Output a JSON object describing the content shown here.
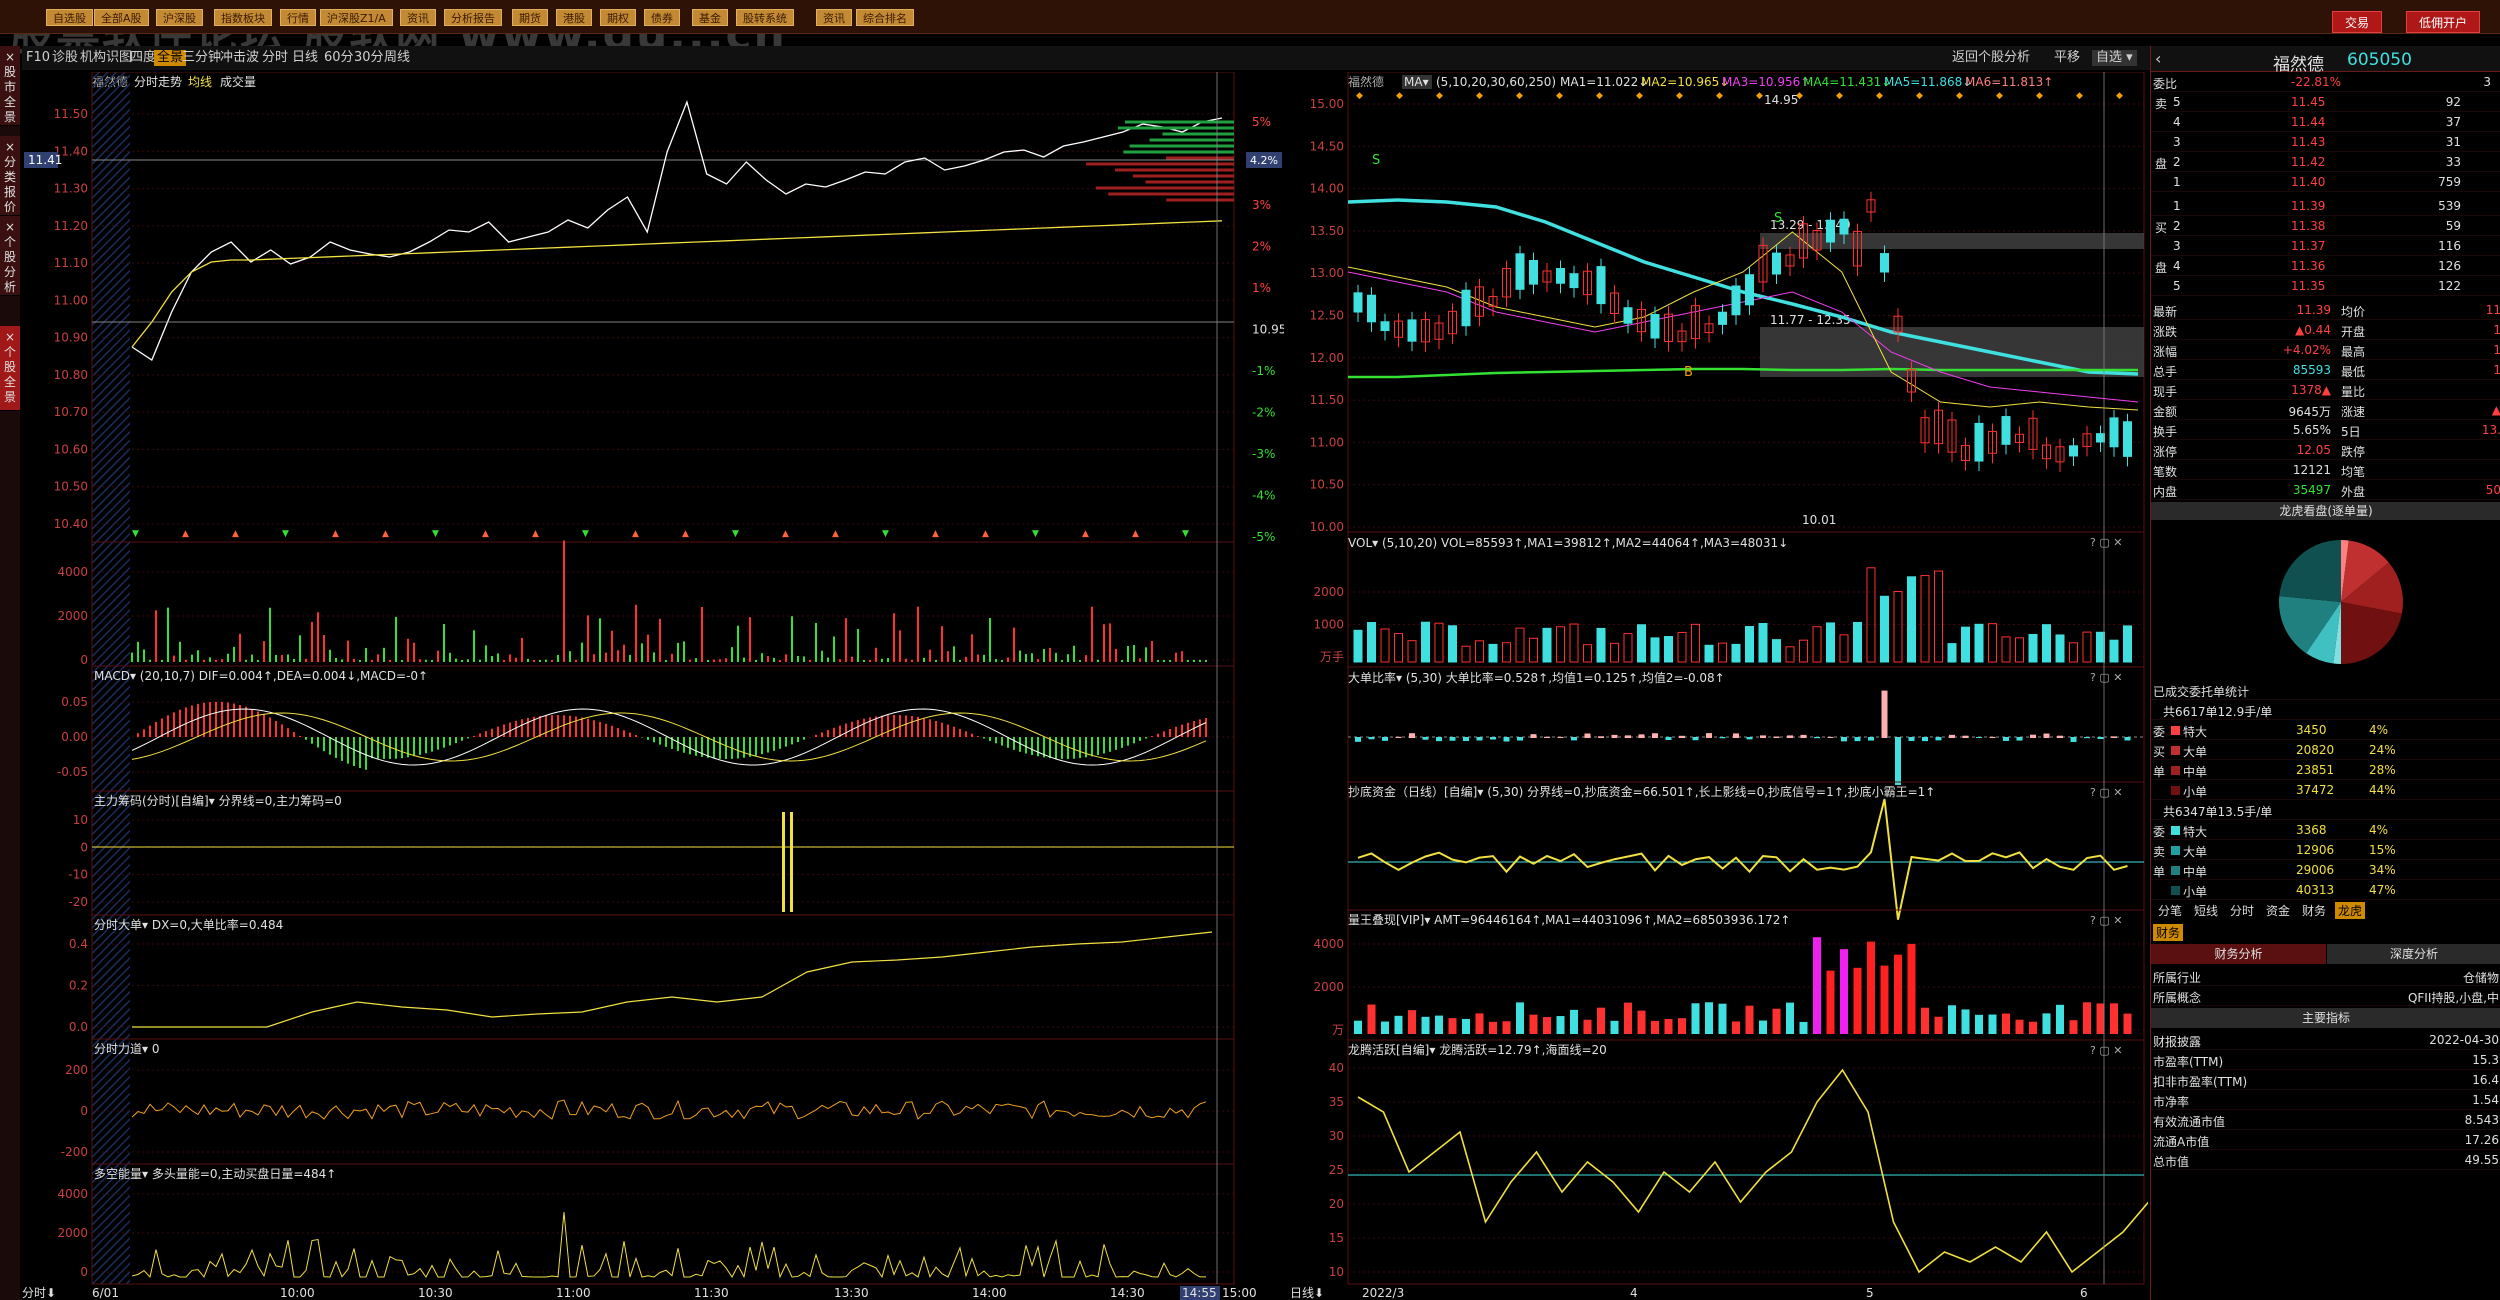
{
  "watermark": "股票软件论坛 股软网 www.gu...cn",
  "topbar": {
    "items": [
      "自选股",
      "全部A股",
      "沪深股",
      "指数板块",
      "行情",
      "沪深股Z1/A",
      "资讯",
      "分析报告",
      "期货",
      "港股",
      "期权",
      "债券",
      "基金",
      "股转系统",
      "资讯",
      "综合排名"
    ],
    "trade": "交易",
    "margin": "低佣开户"
  },
  "toolbar": {
    "items": [
      "F10",
      "诊股",
      "机构",
      "识图",
      "四度",
      "全景",
      "三分钟",
      "冲击波",
      "分时",
      "日线",
      "60分",
      "30分",
      "周线"
    ],
    "right": [
      "返回个股分析",
      "平移",
      "自选"
    ]
  },
  "lefttabs": [
    "股市全景",
    "分类报价",
    "个股分析",
    "个股全景"
  ],
  "intraday": {
    "title": "福然德",
    "mode": "分时走势",
    "avg_label": "均线",
    "vol_label": "成交量",
    "price_ticks": [
      "11.50",
      "11.40",
      "11.30",
      "11.20",
      "11.10",
      "11.00",
      "10.90",
      "10.80",
      "10.70",
      "10.60",
      "10.50",
      "10.40"
    ],
    "pct_ticks": [
      "5%",
      "4.2%",
      "3%",
      "2%",
      "1%",
      "10.95",
      "-1%",
      "-2%",
      "-3%",
      "-4%",
      "-5%"
    ],
    "current_price": "11.41",
    "vol_ticks": [
      "4000",
      "2000",
      "0"
    ],
    "macd_hdr": "MACD▾ (20,10,7) DIF=0.004↑,DEA=0.004↓,MACD=-0↑",
    "macd_ticks": [
      "0.05",
      "0.00",
      "-0.05"
    ],
    "zlcm_hdr": "主力筹码(分时)[自编]▾ 分界线=0,主力筹码=0",
    "zlcm_ticks": [
      "10",
      "0",
      "-10",
      "-20"
    ],
    "fsdd_hdr": "分时大单▾ DX=0,大单比率=0.484",
    "fsdd_ticks": [
      "0.4",
      "0.2",
      "0.0"
    ],
    "fsld_hdr": "分时力道▾ 0",
    "fsld_ticks": [
      "200",
      "0",
      "-200"
    ],
    "dknl_hdr": "多空能量▾ 多头量能=0,主动买盘日量=484↑",
    "dknl_ticks": [
      "4000",
      "2000",
      "0"
    ],
    "time_axis": [
      "分时⬇",
      "6/01",
      "10:00",
      "10:30",
      "11:00",
      "11:30",
      "13:30",
      "14:00",
      "14:30",
      "14:55",
      "15:00"
    ]
  },
  "daily": {
    "title": "福然德",
    "ma_hdr": "MA▾ (5,10,20,30,60,250)",
    "ma_vals": [
      "MA1=11.022↓",
      "MA2=10.965↓",
      "MA3=10.956↑",
      "MA4=11.431↓",
      "MA5=11.868↓",
      "MA6=11.813↑"
    ],
    "price_ticks": [
      "15.00",
      "14.50",
      "14.00",
      "13.50",
      "13.00",
      "12.50",
      "12.00",
      "11.50",
      "11.00",
      "10.50",
      "10.00"
    ],
    "hi_label": "14.95",
    "lo_label": "10.01",
    "zone1": "13.29 - 13.49",
    "zone2": "11.77 - 12.35",
    "vol_hdr": "VOL▾ (5,10,20) VOL=85593↑,MA1=39812↑,MA2=44064↑,MA3=48031↓",
    "vol_ticks": [
      "2000",
      "1000",
      "万手"
    ],
    "ddbl_hdr": "大单比率▾ (5,30) 大单比率=0.528↑,均值1=0.125↑,均值2=-0.08↑",
    "cdzj_hdr": "抄底资金（日线）[自编]▾ (5,30) 分界线=0,抄底资金=66.501↑,长上影线=0,抄底信号=1↑,抄底小霸王=1↑",
    "lwdx_hdr": "量王叠现[VIP]▾ AMT=96446164↑,MA1=44031096↑,MA2=68503936.172↑",
    "lwdx_ticks": [
      "4000",
      "2000",
      "万"
    ],
    "lthy_hdr": "龙腾活跃[自编]▾ 龙腾活跃=12.79↑,海面线=20",
    "lthy_ticks": [
      "40",
      "35",
      "30",
      "25",
      "20",
      "15",
      "10"
    ],
    "date_axis": [
      "日线⬇",
      "2022/3",
      "4",
      "5",
      "6"
    ]
  },
  "quote": {
    "name": "福然德",
    "code": "605050",
    "webi_label": "委比",
    "webi": "-22.81%",
    "webi_num": "3",
    "sell": [
      [
        "卖",
        "5",
        "11.45",
        "92"
      ],
      [
        "",
        "4",
        "11.44",
        "37"
      ],
      [
        "",
        "3",
        "11.43",
        "31"
      ],
      [
        "盘",
        "2",
        "11.42",
        "33"
      ],
      [
        "",
        "1",
        "11.40",
        "759"
      ]
    ],
    "buy": [
      [
        "",
        "1",
        "11.39",
        "539"
      ],
      [
        "买",
        "2",
        "11.38",
        "59"
      ],
      [
        "",
        "3",
        "11.37",
        "116"
      ],
      [
        "盘",
        "4",
        "11.36",
        "126"
      ],
      [
        "",
        "5",
        "11.35",
        "122"
      ]
    ],
    "stats": [
      [
        "最新",
        "11.39",
        "均价",
        "11"
      ],
      [
        "涨跌",
        "▲0.44",
        "开盘",
        "1"
      ],
      [
        "涨幅",
        "+4.02%",
        "最高",
        "1"
      ],
      [
        "总手",
        "85593",
        "最低",
        "1"
      ],
      [
        "现手",
        "1378▲",
        "量比",
        ""
      ],
      [
        "金额",
        "9645万",
        "涨速",
        "▲"
      ],
      [
        "换手",
        "5.65%",
        "5日",
        "13."
      ],
      [
        "涨停",
        "12.05",
        "跌停",
        ""
      ],
      [
        "笔数",
        "12121",
        "均笔",
        ""
      ],
      [
        "内盘",
        "35497",
        "外盘",
        "50"
      ]
    ],
    "pie_title": "龙虎看盘(逐单量)",
    "order_title": "已成交委托单统计",
    "buy_sum": "共6617单12.9手/单",
    "buy_rows": [
      [
        "委",
        "特大",
        "3450",
        "4%"
      ],
      [
        "买",
        "大单",
        "20820",
        "24%"
      ],
      [
        "单",
        "中单",
        "23851",
        "28%"
      ],
      [
        "",
        "小单",
        "37472",
        "44%"
      ]
    ],
    "sell_sum": "共6347单13.5手/单",
    "sell_rows": [
      [
        "委",
        "特大",
        "3368",
        "4%"
      ],
      [
        "卖",
        "大单",
        "12906",
        "15%"
      ],
      [
        "单",
        "中单",
        "29006",
        "34%"
      ],
      [
        "",
        "小单",
        "40313",
        "47%"
      ]
    ],
    "tabs": [
      "分笔",
      "短线",
      "分时",
      "资金",
      "财务",
      "龙虎"
    ],
    "fin_tab": "财务",
    "fin_hdr": [
      "财务分析",
      "深度分析"
    ],
    "industry_label": "所属行业",
    "industry": "仓储物",
    "concept_label": "所属概念",
    "concept": "QFII持股,小盘,中",
    "main_idx": "主要指标",
    "fin_rows": [
      [
        "财报披露",
        "2022-04-30"
      ],
      [
        "市盈率(TTM)",
        "15.3"
      ],
      [
        "扣非市盈率(TTM)",
        "16.4"
      ],
      [
        "市净率",
        "1.54"
      ],
      [
        "有效流通市值",
        "8.543"
      ],
      [
        "流通A市值",
        "17.26"
      ],
      [
        "总市值",
        "49.55"
      ]
    ]
  },
  "colors": {
    "up": "#ff3030",
    "down": "#00e0e0",
    "avg": "#f0e040",
    "bg": "#000",
    "grid": "#5a1010"
  }
}
